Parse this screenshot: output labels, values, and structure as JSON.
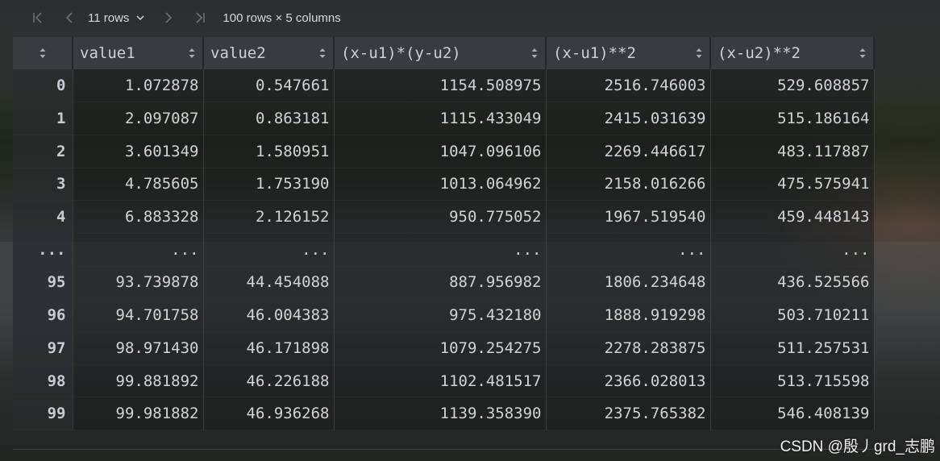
{
  "toolbar": {
    "rows_selector": "11 rows",
    "shape": "100 rows × 5 columns"
  },
  "table": {
    "columns": [
      "value1",
      "value2",
      "(x-u1)*(y-u2)",
      "(x-u1)**2",
      "(x-u2)**2"
    ],
    "rows": [
      {
        "index": "0",
        "cells": [
          "1.072878",
          "0.547661",
          "1154.508975",
          "2516.746003",
          "529.608857"
        ]
      },
      {
        "index": "1",
        "cells": [
          "2.097087",
          "0.863181",
          "1115.433049",
          "2415.031639",
          "515.186164"
        ]
      },
      {
        "index": "2",
        "cells": [
          "3.601349",
          "1.580951",
          "1047.096106",
          "2269.446617",
          "483.117887"
        ]
      },
      {
        "index": "3",
        "cells": [
          "4.785605",
          "1.753190",
          "1013.064962",
          "2158.016266",
          "475.575941"
        ]
      },
      {
        "index": "4",
        "cells": [
          "6.883328",
          "2.126152",
          "950.775052",
          "1967.519540",
          "459.448143"
        ]
      },
      {
        "index": "...",
        "cells": [
          "...",
          "...",
          "...",
          "...",
          "..."
        ]
      },
      {
        "index": "95",
        "cells": [
          "93.739878",
          "44.454088",
          "887.956982",
          "1806.234648",
          "436.525566"
        ]
      },
      {
        "index": "96",
        "cells": [
          "94.701758",
          "46.004383",
          "975.432180",
          "1888.919298",
          "503.710211"
        ]
      },
      {
        "index": "97",
        "cells": [
          "98.971430",
          "46.171898",
          "1079.254275",
          "2278.283875",
          "511.257531"
        ]
      },
      {
        "index": "98",
        "cells": [
          "99.881892",
          "46.226188",
          "1102.481517",
          "2366.028013",
          "513.715598"
        ]
      },
      {
        "index": "99",
        "cells": [
          "99.981882",
          "46.936268",
          "1139.358390",
          "2375.765382",
          "546.408139"
        ]
      }
    ]
  },
  "watermark": "CSDN @殷丿grd_志鹏",
  "icons": {
    "first": "first-page-icon",
    "prev": "prev-page-icon",
    "next": "next-page-icon",
    "last": "last-page-icon",
    "dropdown": "chevron-down-icon",
    "sort": "sort-icon"
  }
}
